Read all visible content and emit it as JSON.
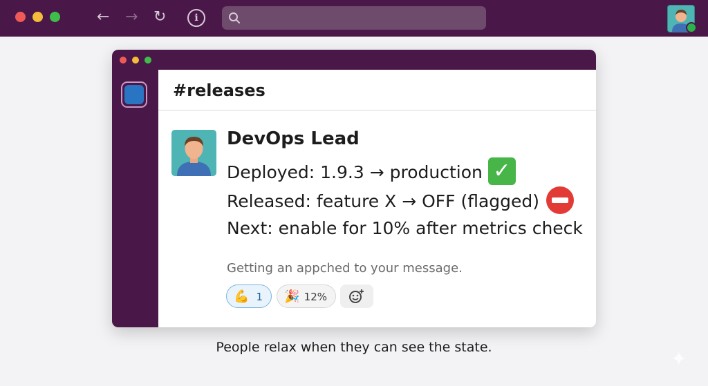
{
  "browser": {
    "search_placeholder": "",
    "nav": {
      "back": "←",
      "forward": "→",
      "reload": "↻",
      "info": "i"
    }
  },
  "channel": {
    "name": "#releases"
  },
  "message": {
    "author": "DevOps Lead",
    "lines": [
      "Deployed: 1.9.3 → production",
      "Released: feature X → OFF (flagged)",
      "Next: enable for 10% after metrics check"
    ],
    "line_icons": [
      "check-mark-emoji",
      "no-entry-emoji"
    ],
    "check_glyph": "✓",
    "hint": "Getting an appched to your message."
  },
  "reactions": [
    {
      "icon": "💪",
      "count": "1"
    },
    {
      "icon": "🎉",
      "count": "12%"
    },
    {
      "icon": "☺",
      "count": ""
    }
  ],
  "caption": "People relax when they can see the state.",
  "colors": {
    "chrome": "#4a1848",
    "accent_blue": "#2a74c4",
    "check_green": "#48b548",
    "no_entry_red": "#e23a34"
  }
}
